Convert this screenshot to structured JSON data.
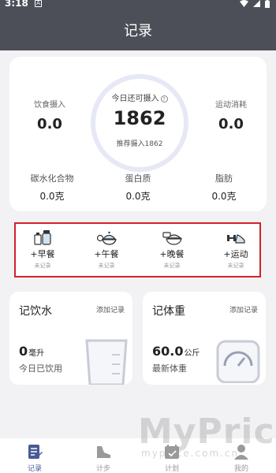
{
  "status_bar": {
    "time": "3:18",
    "notification": "A"
  },
  "header": {
    "title": "记录"
  },
  "summary": {
    "intake": {
      "label": "饮食摄入",
      "value": "0.0"
    },
    "burn": {
      "label": "运动消耗",
      "value": "0.0"
    },
    "remaining": {
      "label": "今日还可摄入",
      "help": "?",
      "value": "1862",
      "recommend": "推荐摄入1862"
    },
    "macros": [
      {
        "label": "碳水化合物",
        "value": "0.0克"
      },
      {
        "label": "蛋白质",
        "value": "0.0克"
      },
      {
        "label": "脂肪",
        "value": "0.0克"
      }
    ]
  },
  "meals": [
    {
      "label": "+早餐",
      "status": "未记录",
      "icon": "breakfast-icon"
    },
    {
      "label": "+午餐",
      "status": "未记录",
      "icon": "lunch-icon"
    },
    {
      "label": "+晚餐",
      "status": "未记录",
      "icon": "dinner-icon"
    },
    {
      "label": "+运动",
      "status": "未记录",
      "icon": "exercise-icon"
    }
  ],
  "water_card": {
    "title": "记饮水",
    "add": "添加记录",
    "value": "0",
    "unit": "毫升",
    "sub": "今日已饮用"
  },
  "weight_card": {
    "title": "记体重",
    "add": "添加记录",
    "value": "60.0",
    "unit": "公斤",
    "sub": "最新体重"
  },
  "tabs": [
    {
      "label": "记录",
      "icon": "record-icon",
      "active": true
    },
    {
      "label": "计步",
      "icon": "shoe-icon",
      "active": false
    },
    {
      "label": "计划",
      "icon": "calendar-icon",
      "active": false
    },
    {
      "label": "我的",
      "icon": "profile-icon",
      "active": false
    }
  ],
  "watermark": {
    "brand": "MyPrice",
    "site": "myprice.com.cn"
  },
  "colors": {
    "header": "#4d4f58",
    "accent": "#4a5a96",
    "highlight_border": "#d2222a",
    "ring": "#e6e8f5"
  }
}
